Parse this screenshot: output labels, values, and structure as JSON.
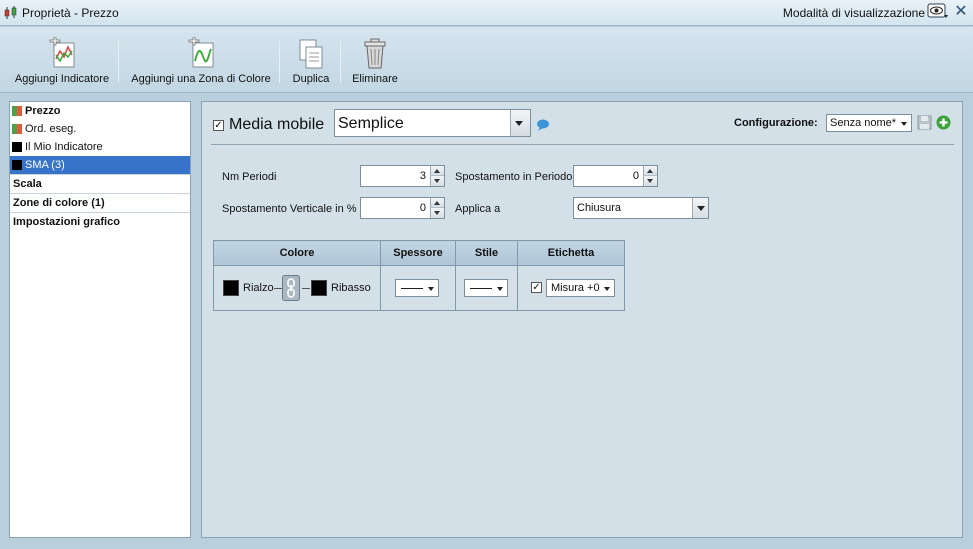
{
  "window": {
    "title": "Proprietà - Prezzo",
    "view_mode_label": "Modalità di visualizzazione"
  },
  "toolbar": {
    "add_indicator": "Aggiungi Indicatore",
    "add_color_zone": "Aggiungi una Zona di Colore",
    "duplicate": "Duplica",
    "delete": "Eliminare"
  },
  "tree": {
    "items": [
      {
        "label": "Prezzo",
        "swatch": "#4aa34a",
        "swatch2": "#e05c3c",
        "bold": true
      },
      {
        "label": "Ord. eseg.",
        "swatch": "#4aa34a",
        "swatch2": "#e05c3c"
      },
      {
        "label": "Il Mio Indicatore",
        "swatch": "#000000"
      },
      {
        "label": "SMA (3)",
        "swatch": "#000000",
        "selected": true
      }
    ],
    "sections": [
      "Scala",
      "Zone di colore (1)",
      "Impostazioni grafico"
    ]
  },
  "indicator": {
    "enabled_label": "Media mobile",
    "type_value": "Semplice",
    "config_label": "Configurazione:",
    "config_value": "Senza nome*"
  },
  "params": {
    "periods_label": "Nm Periodi",
    "periods_value": "3",
    "shift_period_label": "Spostamento in Periodo",
    "shift_period_value": "0",
    "vertical_shift_label": "Spostamento Verticale in %",
    "vertical_shift_value": "0",
    "apply_to_label": "Applica a",
    "apply_to_value": "Chiusura"
  },
  "style_table": {
    "headers": [
      "Colore",
      "Spessore",
      "Stile",
      "Etichetta"
    ],
    "rise_label": "Rialzo",
    "fall_label": "Ribasso",
    "label_value": "Misura +0"
  },
  "colors": {
    "selection": "#3773c8",
    "rise": "#000000",
    "fall": "#000000",
    "accent_green": "#3ba13b"
  }
}
